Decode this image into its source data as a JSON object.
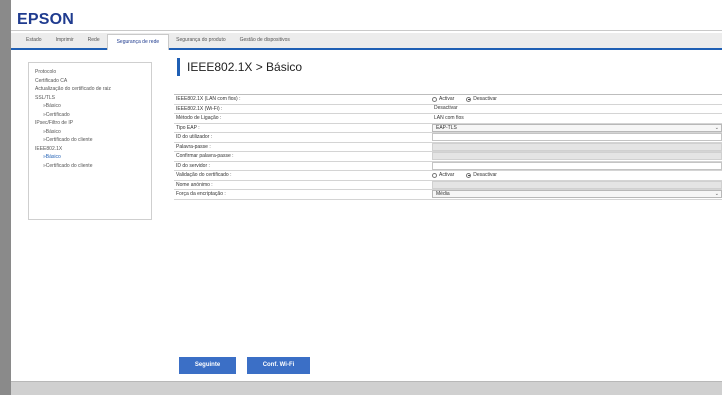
{
  "brand": {
    "logo": "EPSON"
  },
  "tabs": [
    {
      "label": "Estado",
      "active": false
    },
    {
      "label": "Imprimir",
      "active": false
    },
    {
      "label": "Rede",
      "active": false
    },
    {
      "label": "Segurança de rede",
      "active": true
    },
    {
      "label": "Segurança do produto",
      "active": false
    },
    {
      "label": "Gestão de dispositivos",
      "active": false
    }
  ],
  "sidebar": {
    "items": [
      {
        "label": "Protocolo",
        "sub": false,
        "active": false
      },
      {
        "label": "Certificado CA",
        "sub": false,
        "active": false
      },
      {
        "label": "Actualização do certificado de raiz",
        "sub": false,
        "active": false
      },
      {
        "label": "SSL/TLS",
        "sub": false,
        "active": false
      },
      {
        "label": "»Básico",
        "sub": true,
        "active": false
      },
      {
        "label": "»Certificado",
        "sub": true,
        "active": false
      },
      {
        "label": "IPsec/Filtro de IP",
        "sub": false,
        "active": false
      },
      {
        "label": "»Básico",
        "sub": true,
        "active": false
      },
      {
        "label": "»Certificado do cliente",
        "sub": true,
        "active": false
      },
      {
        "label": "IEEE802.1X",
        "sub": false,
        "active": false
      },
      {
        "label": "»Básico",
        "sub": true,
        "active": true
      },
      {
        "label": "»Certificado do cliente",
        "sub": true,
        "active": false
      }
    ]
  },
  "page": {
    "title": "IEEE802.1X > Básico"
  },
  "settings": {
    "lan": {
      "label": "IEEE802.1X (LAN com fios) :",
      "opt1": "Activar",
      "opt2": "Desactivar",
      "selected": "Desactivar"
    },
    "wifi": {
      "label": "IEEE802.1X (Wi-Fi) :",
      "value": "Desactivar"
    },
    "connection": {
      "label": "Método de Ligação :",
      "value": "LAN com fios"
    },
    "eap": {
      "label": "Tipo EAP :",
      "value": "EAP-TLS"
    },
    "user_id": {
      "label": "ID do utilizador :",
      "value": ""
    },
    "password": {
      "label": "Palavra-passe :",
      "value": ""
    },
    "confirm": {
      "label": "Confirmar palavra-passe :",
      "value": ""
    },
    "server_id": {
      "label": "ID do servidor :",
      "value": ""
    },
    "cert_validation": {
      "label": "Validação do certificado :",
      "opt1": "Activar",
      "opt2": "Desactivar",
      "selected": "Desactivar"
    },
    "anon_name": {
      "label": "Nome anónimo :",
      "value": ""
    },
    "encryption": {
      "label": "Força da encriptação :",
      "value": "Média"
    }
  },
  "buttons": {
    "next": "Seguinte",
    "wifi": "Conf. Wi-Fi"
  },
  "colors": {
    "accent": "#1f5fb4",
    "button": "#3b6fc6",
    "brand": "#1f3b8f"
  }
}
